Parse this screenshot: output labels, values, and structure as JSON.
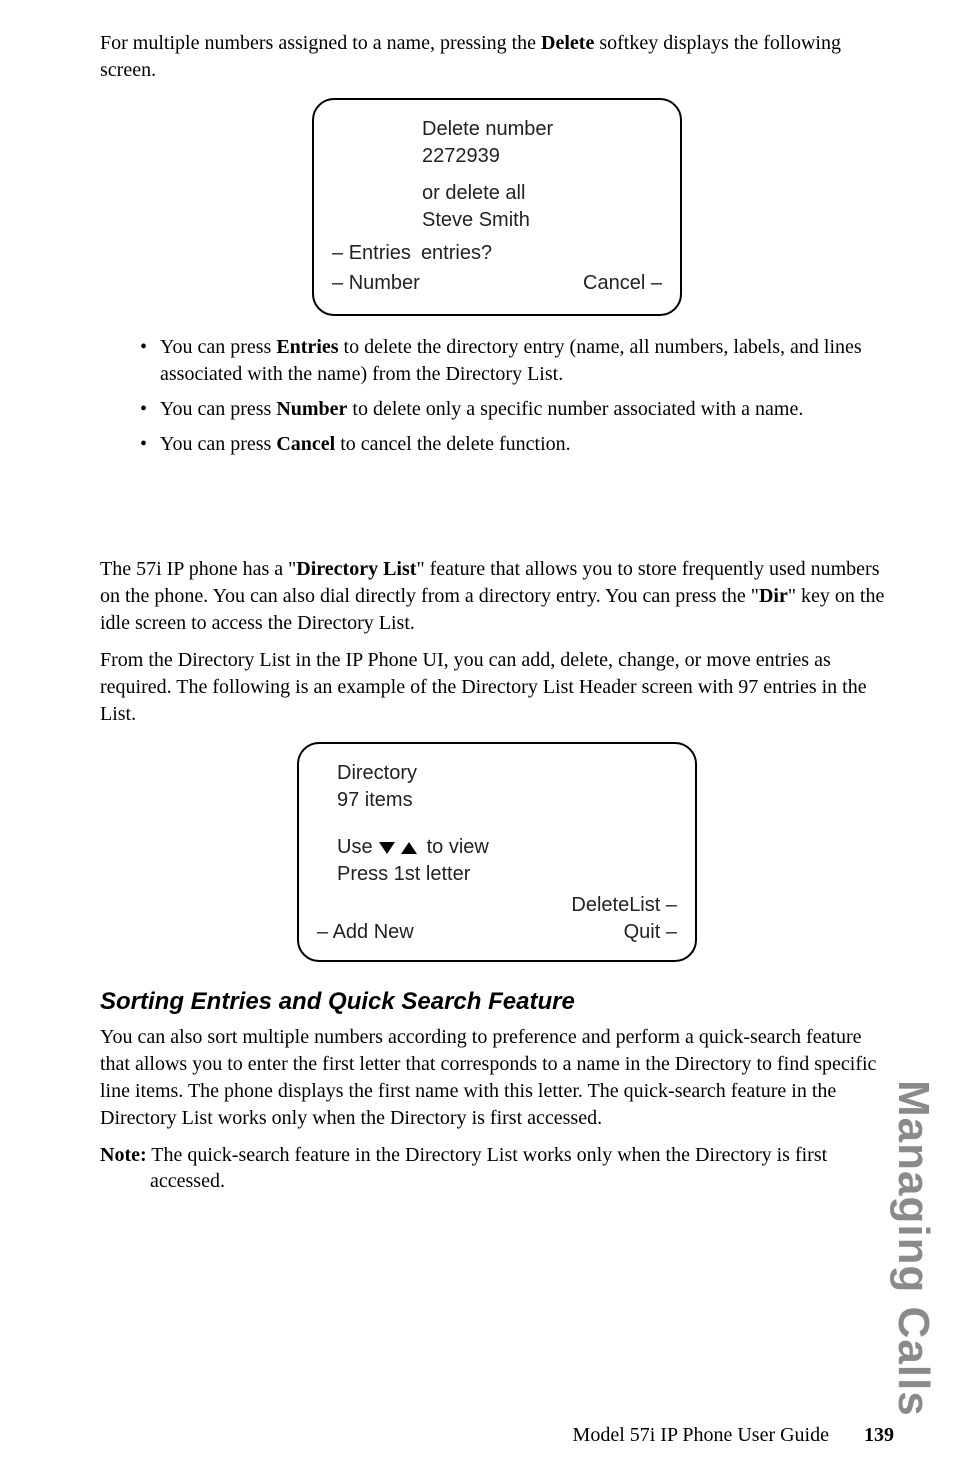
{
  "intro": {
    "pre": "For multiple numbers assigned to a name, pressing the ",
    "bold": "Delete",
    "post": " softkey displays the following screen."
  },
  "screen1": {
    "line1": "Delete number",
    "line2": "2272939",
    "line3": "or delete all",
    "line4": "Steve Smith",
    "entries_label": "Entries",
    "entries_tail": "entries?",
    "number_label": "Number",
    "cancel_label": "Cancel"
  },
  "bullets": {
    "b1_pre": "You can press ",
    "b1_bold": "Entries",
    "b1_post": " to delete the directory entry (name, all numbers, labels, and lines associated with the name) from the Directory List.",
    "b2_pre": "You can press ",
    "b2_bold": "Number",
    "b2_post": " to delete only a specific number associated with a name.",
    "b3_pre": "You can press ",
    "b3_bold": "Cancel",
    "b3_post": " to cancel the delete function."
  },
  "para2": {
    "p1_pre": "The 57i IP phone has a \"",
    "p1_bold": "Directory List",
    "p1_mid": "\" feature that allows you to store frequently used numbers on the phone. You can also dial directly from a directory entry. You can press the \"",
    "p1_bold2": "Dir",
    "p1_post": "\" key on the idle screen to access the Directory List.",
    "p2": "From the Directory List in the IP Phone UI, you can add, delete, change, or move entries as required. The following is an example of the Directory List Header screen with 97 entries in the List."
  },
  "screen2": {
    "title": "Directory",
    "count": "97 items",
    "use_pre": "Use",
    "use_post": "to view",
    "press": "Press 1st letter",
    "deletelist": "DeleteList",
    "addnew": "Add New",
    "quit": "Quit"
  },
  "subhead": "Sorting Entries and Quick Search Feature",
  "para3": "You can also sort multiple numbers according to preference and perform a quick-search feature that allows you to enter the first letter that corresponds to a name in the Directory to find specific line items. The phone displays the first name with this letter. The quick-search feature in the Directory List works only when the Directory is first accessed.",
  "note": {
    "label": "Note:",
    "text": " The quick-search feature in the Directory List works only when the Directory is first accessed."
  },
  "side_tab": "Managing Calls",
  "footer": {
    "text": "Model 57i IP Phone User Guide",
    "page": "139"
  }
}
